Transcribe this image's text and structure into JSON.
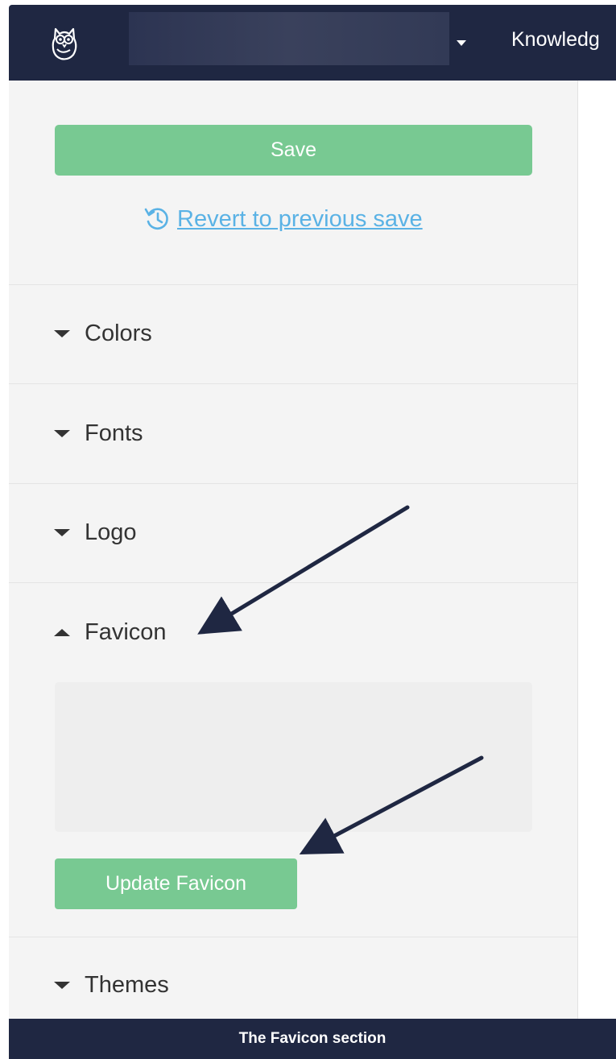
{
  "topbar": {
    "logo_icon": "owl-logo-icon",
    "project_select_caret_icon": "caret-down-icon",
    "nav_link": "Knowledg"
  },
  "panel": {
    "save_label": "Save",
    "revert_icon": "history-icon",
    "revert_label": "Revert to previous save",
    "sections": {
      "colors": "Colors",
      "fonts": "Fonts",
      "logo": "Logo",
      "favicon": "Favicon",
      "themes": "Themes"
    },
    "update_favicon_label": "Update Favicon"
  },
  "caption": "The Favicon section",
  "colors": {
    "topbar": "#1f2742",
    "primary_button": "#78c992",
    "link": "#5ab2e5",
    "panel_bg": "#f4f4f4",
    "annotation_arrow": "#1f2742"
  }
}
